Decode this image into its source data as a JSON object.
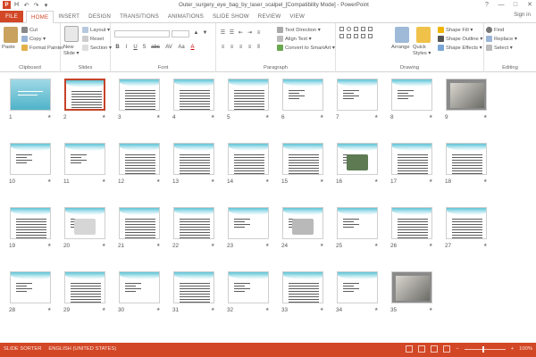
{
  "window": {
    "title": "Outer_surgery_eye_bag_by_laser_scalpel_[Compatibility Mode] - PowerPoint",
    "controls": [
      "?",
      "—",
      "□",
      "✕"
    ]
  },
  "quick_access": [
    "P",
    "H",
    "↶",
    "↷",
    "▾"
  ],
  "tabs": [
    "FILE",
    "HOME",
    "INSERT",
    "DESIGN",
    "TRANSITIONS",
    "ANIMATIONS",
    "SLIDE SHOW",
    "REVIEW",
    "VIEW"
  ],
  "active_tab": "HOME",
  "signin": "Sign in",
  "ribbon": {
    "clipboard": {
      "label": "Clipboard",
      "paste": "Paste",
      "cut": "Cut",
      "copy": "Copy ▾",
      "format_painter": "Format Painter"
    },
    "slides": {
      "label": "Slides",
      "new_slide": "New Slide ▾",
      "layout": "Layout ▾",
      "reset": "Reset",
      "section": "Section ▾"
    },
    "font": {
      "label": "Font",
      "buttons": [
        "B",
        "I",
        "U",
        "S",
        "abc",
        "AV",
        "Aa",
        "A"
      ]
    },
    "paragraph": {
      "label": "Paragraph",
      "text_direction": "Text Direction ▾",
      "align_text": "Align Text ▾",
      "smartart": "Convert to SmartArt ▾"
    },
    "drawing": {
      "label": "Drawing",
      "arrange": "Arrange",
      "quick_styles": "Quick Styles ▾",
      "shape_fill": "Shape Fill ▾",
      "shape_outline": "Shape Outline ▾",
      "shape_effects": "Shape Effects ▾"
    },
    "editing": {
      "label": "Editing",
      "find": "Find",
      "replace": "Replace ▾",
      "select": "Select ▾"
    }
  },
  "slides": [
    {
      "n": "1",
      "kind": "title"
    },
    {
      "n": "2",
      "kind": "text",
      "selected": true
    },
    {
      "n": "3",
      "kind": "text"
    },
    {
      "n": "4",
      "kind": "text"
    },
    {
      "n": "5",
      "kind": "text"
    },
    {
      "n": "6",
      "kind": "light"
    },
    {
      "n": "7",
      "kind": "light"
    },
    {
      "n": "8",
      "kind": "light"
    },
    {
      "n": "9",
      "kind": "photo"
    },
    {
      "n": "10",
      "kind": "light"
    },
    {
      "n": "11",
      "kind": "light"
    },
    {
      "n": "12",
      "kind": "text"
    },
    {
      "n": "13",
      "kind": "text"
    },
    {
      "n": "14",
      "kind": "text"
    },
    {
      "n": "15",
      "kind": "text"
    },
    {
      "n": "16",
      "kind": "device"
    },
    {
      "n": "17",
      "kind": "text"
    },
    {
      "n": "18",
      "kind": "text"
    },
    {
      "n": "19",
      "kind": "text"
    },
    {
      "n": "20",
      "kind": "device2"
    },
    {
      "n": "21",
      "kind": "text"
    },
    {
      "n": "22",
      "kind": "text"
    },
    {
      "n": "23",
      "kind": "light"
    },
    {
      "n": "24",
      "kind": "machine"
    },
    {
      "n": "25",
      "kind": "light"
    },
    {
      "n": "26",
      "kind": "text"
    },
    {
      "n": "27",
      "kind": "text"
    },
    {
      "n": "28",
      "kind": "light"
    },
    {
      "n": "29",
      "kind": "text"
    },
    {
      "n": "30",
      "kind": "light"
    },
    {
      "n": "31",
      "kind": "text"
    },
    {
      "n": "32",
      "kind": "light"
    },
    {
      "n": "33",
      "kind": "text"
    },
    {
      "n": "34",
      "kind": "light"
    },
    {
      "n": "35",
      "kind": "photo"
    }
  ],
  "status": {
    "slide_sorter": "SLIDE SORTER",
    "language": "ENGLISH (UNITED STATES)",
    "zoom": "100%"
  },
  "colors": {
    "accent": "#d24726",
    "wave": "#5ec3d6"
  }
}
